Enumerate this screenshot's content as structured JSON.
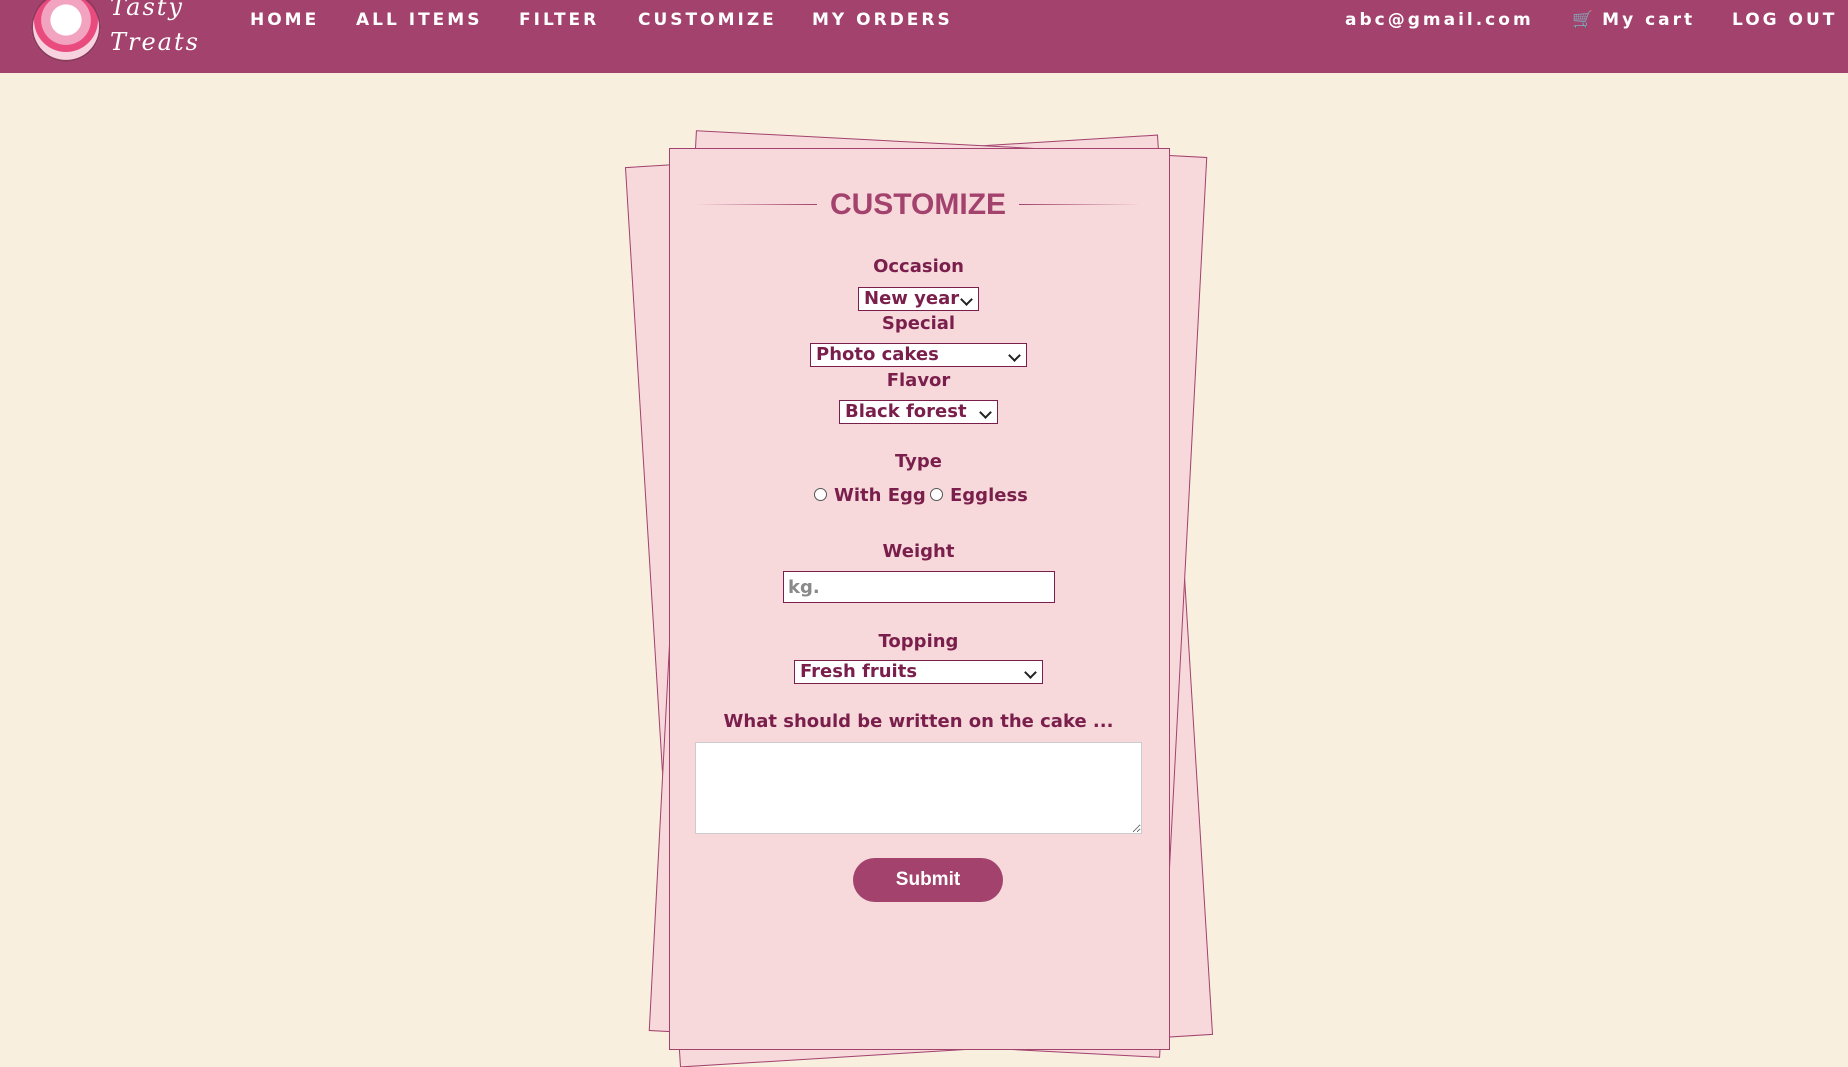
{
  "brand": {
    "line1": "Tasty",
    "line2": "Treats",
    "logo_icon": "cupcake-logo-icon"
  },
  "nav": {
    "home": "HOME",
    "all_items": "ALL ITEMS",
    "filter": "FILTER",
    "customize": "CUSTOMIZE",
    "my_orders": "MY ORDERS",
    "email": "abc@gmail.com",
    "cart": "My cart",
    "cart_icon": "cart-icon",
    "logout": "LOG OUT"
  },
  "form": {
    "title": "CUSTOMIZE",
    "occasion": {
      "label": "Occasion",
      "value": "New year"
    },
    "special": {
      "label": "Special",
      "value": "Photo cakes"
    },
    "flavor": {
      "label": "Flavor",
      "value": "Black forest"
    },
    "type": {
      "label": "Type",
      "options": [
        "With Egg",
        "Eggless"
      ]
    },
    "weight": {
      "label": "Weight",
      "placeholder": "kg."
    },
    "topping": {
      "label": "Topping",
      "value": "Fresh fruits"
    },
    "message": {
      "label": "What should be written on the cake ..."
    },
    "submit": "Submit"
  },
  "colors": {
    "primary": "#a2426d",
    "background": "#f8efde",
    "card": "#f7d9dc",
    "label": "#7a1f4b"
  }
}
